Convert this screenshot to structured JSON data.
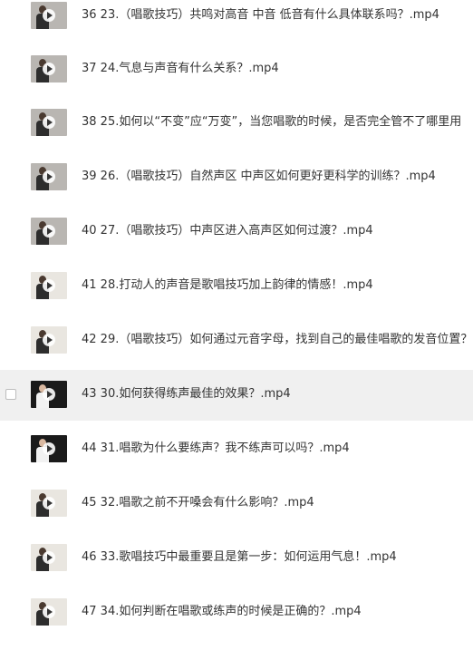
{
  "files": [
    {
      "name": "36 23.（唱歌技巧）共鸣对高音 中音 低音有什么具体联系吗？.mp4",
      "thumb": "gray"
    },
    {
      "name": "37 24.气息与声音有什么关系？.mp4",
      "thumb": "gray"
    },
    {
      "name": "38 25.如何以“不变”应“万变”，当您唱歌的时候，是否完全管不了哪里用",
      "thumb": "gray"
    },
    {
      "name": "39 26.（唱歌技巧）自然声区 中声区如何更好更科学的训练？.mp4",
      "thumb": "gray"
    },
    {
      "name": "40 27.（唱歌技巧）中声区进入高声区如何过渡？.mp4",
      "thumb": "gray"
    },
    {
      "name": "41 28.打动人的声音是歌唱技巧加上韵律的情感！.mp4",
      "thumb": "light"
    },
    {
      "name": "42 29.（唱歌技巧）如何通过元音字母，找到自己的最佳唱歌的发音位置？.m",
      "thumb": "light"
    },
    {
      "name": "43 30.如何获得练声最佳的效果？.mp4",
      "thumb": "dark",
      "selected": true
    },
    {
      "name": "44 31.唱歌为什么要练声？我不练声可以吗？.mp4",
      "thumb": "dark"
    },
    {
      "name": "45 32.唱歌之前不开嗓会有什么影响？.mp4",
      "thumb": "light"
    },
    {
      "name": "46 33.歌唱技巧中最重要且是第一步：如何运用气息！.mp4",
      "thumb": "light"
    },
    {
      "name": "47 34.如何判断在唱歌或练声的时候是正确的？.mp4",
      "thumb": "light"
    }
  ]
}
